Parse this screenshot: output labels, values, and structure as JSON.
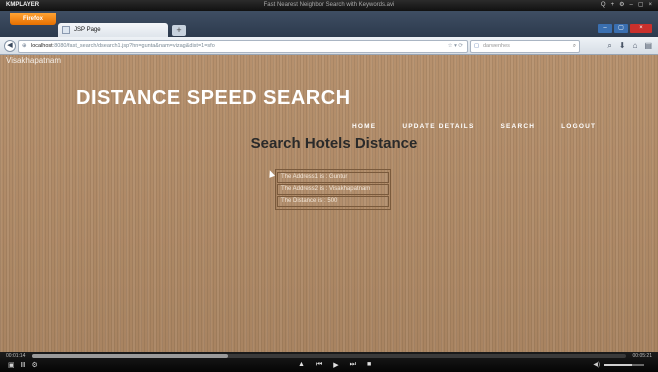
{
  "player": {
    "brand": "KMPLAYER",
    "title": "Fast Nearest Neighbor Search with Keywords.avi",
    "top_controls": [
      "Q",
      "+",
      "⚙",
      "–",
      "▢",
      "×"
    ],
    "time_current": "00:01:14",
    "time_total": "00:05:21",
    "progress": 0.33,
    "bottom_left": [
      "▣",
      "Ⅲ",
      "⚙"
    ],
    "transport": [
      "▲",
      "⏮",
      "▶",
      "⏭",
      "■"
    ],
    "volume_icon": "◀)",
    "volume_level": 0.7
  },
  "browser": {
    "menu_label": "Firefox",
    "tab_title": "JSP Page",
    "newtab_label": "+",
    "window_buttons": [
      "–",
      "▢",
      "×"
    ],
    "back_glyph": "◀",
    "url_host": "localhost",
    "url_rest": ":8080/fast_search/dsearch1.jsp?hn=gunta&nam=vizag&dist=1=sfo",
    "search_placeholder": "darwenhes",
    "toolbar_icons": [
      "⌕",
      "⬇",
      "⌂",
      "▤"
    ]
  },
  "page": {
    "city": "Visakhapatnam",
    "site_title": "DISTANCE SPEED SEARCH",
    "nav": [
      "HOME",
      "UPDATE DETAILS",
      "SEARCH",
      "LOGOUT"
    ],
    "heading": "Search Hotels Distance",
    "results": [
      "The Address1 is : Guntur",
      "The Address2 is : Visakhapatnam",
      "The Distance is : 500"
    ]
  },
  "colors": {
    "page_background": "#b38c67",
    "title_text": "#ffffff",
    "heading_text": "#2a2a2a",
    "firefox_orange": "#e66f00"
  }
}
